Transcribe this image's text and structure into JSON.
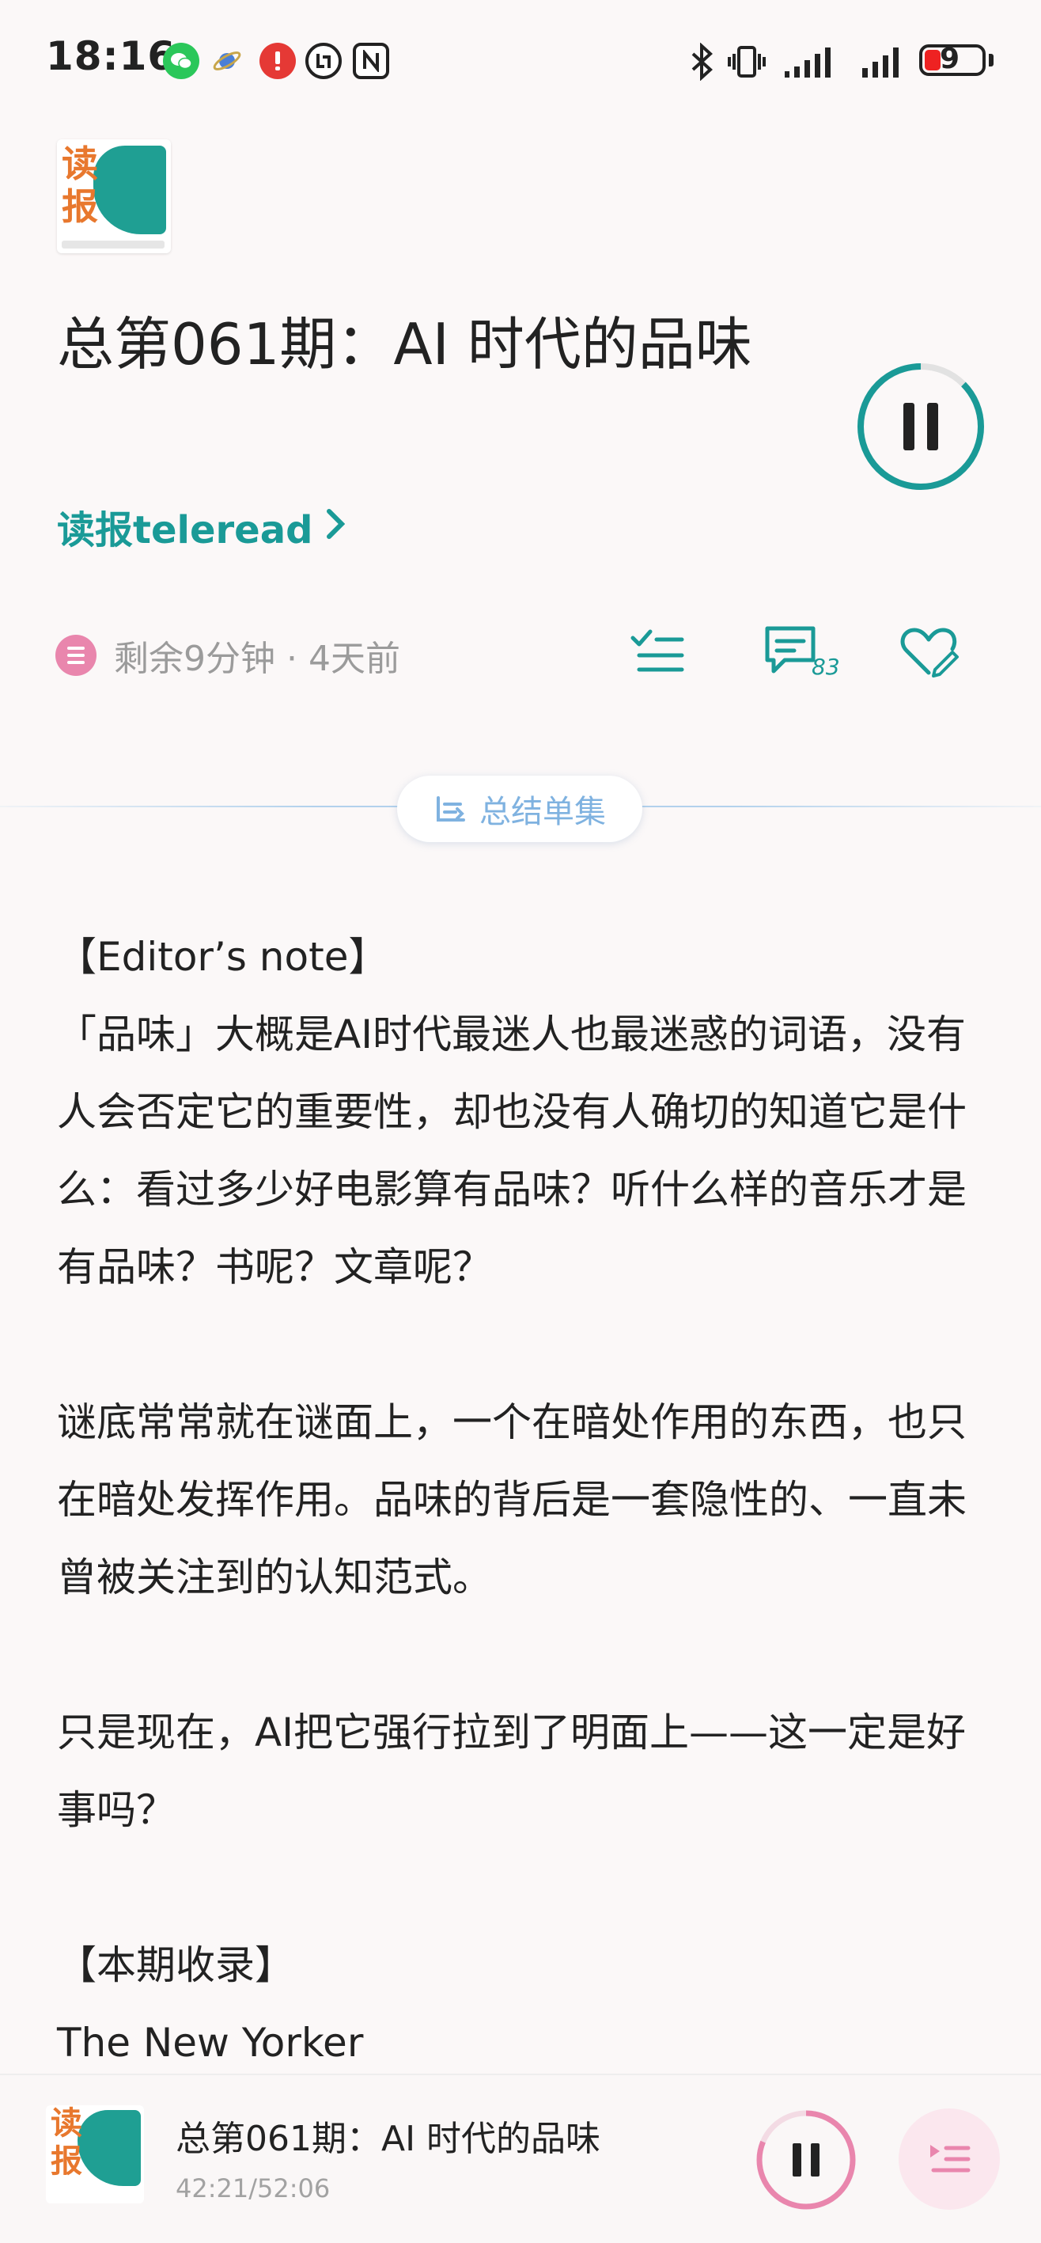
{
  "status_bar": {
    "time": "18:16",
    "battery": "9"
  },
  "podcast": {
    "cover_text_1": "读",
    "cover_text_2": "报"
  },
  "episode": {
    "title": "总第061期：AI 时代的品味",
    "author": "读报teleread",
    "meta": "剩余9分钟 · 4天前",
    "comment_count": "83"
  },
  "summary_button": {
    "label": "总结单集"
  },
  "article": {
    "paragraphs": [
      "【Editor’s note】",
      "「品味」大概是AI时代最迷人也最迷惑的词语，没有人会否定它的重要性，却也没有人确切的知道它是什么：看过多少好电影算有品味？听什么样的音乐才是有品味？书呢？文章呢？",
      "谜底常常就在谜面上，一个在暗处作用的东西，也只在暗处发挥作用。品味的背后是一套隐性的、一直未曾被关注到的认知范式。",
      "只是现在，AI把它强行拉到了明面上——这一定是好事吗？",
      "【本期收录】",
      "The New Yorker"
    ]
  },
  "player": {
    "title": "总第061期：AI 时代的品味",
    "time": "42:21/52:06",
    "progress": 0.813
  },
  "colors": {
    "accent_teal": "#1a9a97",
    "accent_pink": "#e986ad",
    "summary_blue": "#7fb2e0"
  },
  "icons": [
    "wechat-icon",
    "app-icon",
    "alert-icon",
    "vpn-icon",
    "nfc-icon",
    "bluetooth-icon",
    "vibrate-icon",
    "signal-icon",
    "pause-icon",
    "playlist-check-icon",
    "comment-icon",
    "heart-edit-icon",
    "summary-icon",
    "queue-icon"
  ]
}
